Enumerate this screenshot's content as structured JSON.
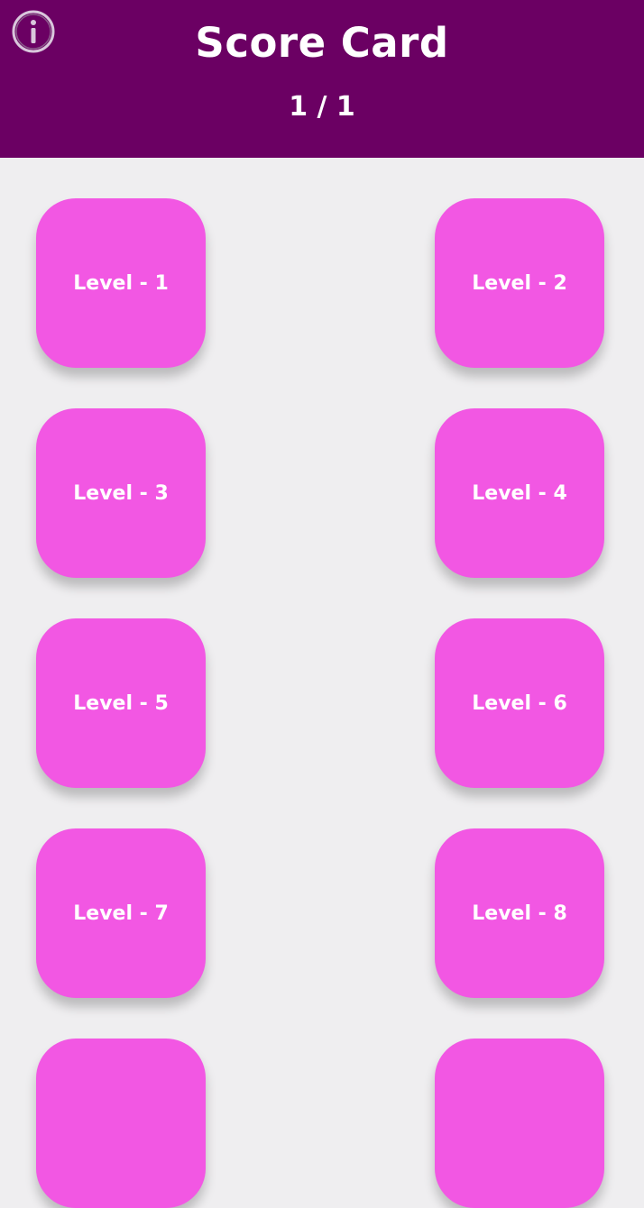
{
  "header": {
    "title": "Score Card",
    "progress": "1 / 1",
    "background_color": "#6b0063",
    "info_icon": "info-circle-icon"
  },
  "levels": [
    {
      "label": "Level - 1"
    },
    {
      "label": "Level - 2"
    },
    {
      "label": "Level - 3"
    },
    {
      "label": "Level - 4"
    },
    {
      "label": "Level - 5"
    },
    {
      "label": "Level - 6"
    },
    {
      "label": "Level - 7"
    },
    {
      "label": "Level - 8"
    },
    {
      "label": ""
    },
    {
      "label": ""
    }
  ],
  "colors": {
    "tile": "#f257e3",
    "page_background": "#efeef0",
    "text": "#ffffff"
  }
}
